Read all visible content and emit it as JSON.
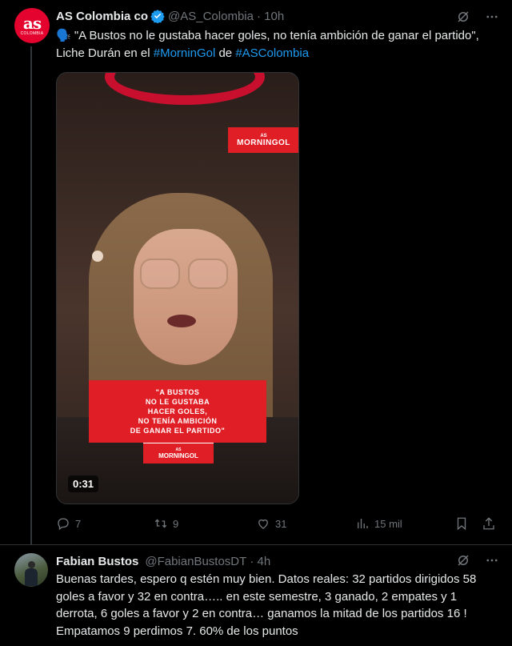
{
  "tweet1": {
    "display_name": "AS Colombia co",
    "handle": "@AS_Colombia",
    "time": "· 10h",
    "avatar_text": "as",
    "avatar_sub": "COLOMBIA",
    "text_prefix": "🗣️ \"A Bustos no le gustaba hacer goles, no tenía ambición de ganar el partido\", Liche Durán en el ",
    "hashtag1": "#MorninGol",
    "text_mid": " de ",
    "hashtag2": "#ASColombia",
    "media": {
      "badge_as": "AS",
      "badge_text": "MORNINGOL",
      "quote_text": "\"A BUSTOS\nNO LE GUSTABA\nHACER GOLES,\nNO TENÍA AMBICIÓN\nDE GANAR EL PARTIDO\"",
      "quote_logo_as": "AS",
      "quote_logo_text": "MORNINGOL",
      "duration": "0:31"
    },
    "actions": {
      "replies": "7",
      "retweets": "9",
      "likes": "31",
      "views": "15 mil"
    }
  },
  "tweet2": {
    "display_name": "Fabian Bustos",
    "handle": "@FabianBustosDT",
    "time": "· 4h",
    "text": "Buenas tardes, espero q estén muy bien. Datos reales: 32 partidos dirigidos 58 goles a favor y 32 en contra….. en este semestre, 3 ganado, 2 empates y 1 derrota, 6 goles a favor y 2 en contra… ganamos la mitad de los partidos 16 ! Empatamos 9 perdimos 7. 60% de los puntos"
  },
  "colors": {
    "background": "#000000",
    "link": "#1d9bf0",
    "muted": "#71767b",
    "verified": "#1d9bf0",
    "brand_red": "#e01e25"
  },
  "icons": [
    "grok-icon",
    "more-icon",
    "verified-badge-icon",
    "reply-icon",
    "retweet-icon",
    "like-icon",
    "views-icon",
    "bookmark-icon",
    "share-icon"
  ]
}
